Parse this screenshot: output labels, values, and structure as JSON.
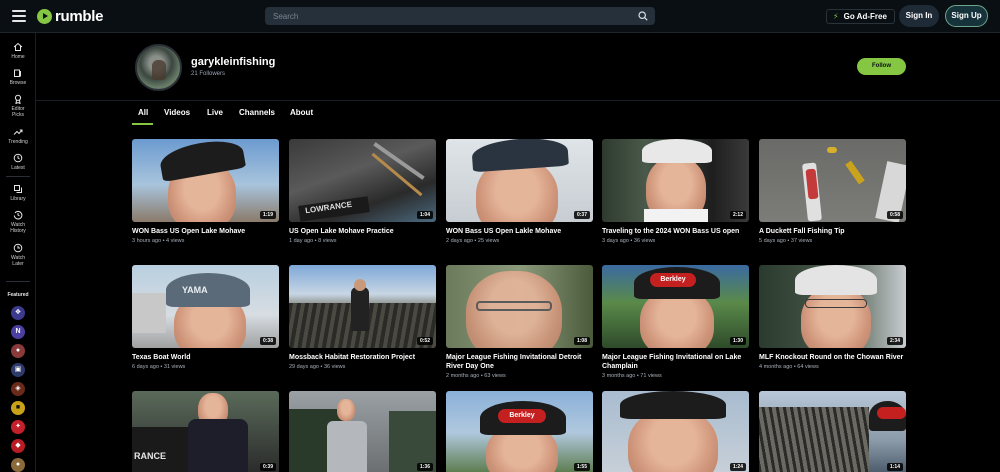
{
  "header": {
    "logo_text": "rumble",
    "search_placeholder": "Search",
    "go_ad_free": "Go Ad-Free",
    "sign_in": "Sign In",
    "sign_up": "Sign Up"
  },
  "sidebar": {
    "items": [
      {
        "label": "Home",
        "icon": "home-icon"
      },
      {
        "label": "Browse",
        "icon": "browse-icon"
      },
      {
        "label": "Editor Picks",
        "icon": "award-icon"
      },
      {
        "label": "Trending",
        "icon": "trending-icon"
      },
      {
        "label": "Latest",
        "icon": "clock-icon"
      },
      {
        "label": "Library",
        "icon": "library-icon"
      },
      {
        "label": "Watch History",
        "icon": "history-icon"
      },
      {
        "label": "Watch Later",
        "icon": "watch-later-icon"
      }
    ],
    "featured_title": "Featured"
  },
  "channel": {
    "name": "garykleinfishing",
    "followers": "21 Followers",
    "follow_label": "Follow"
  },
  "tabs": [
    "All",
    "Videos",
    "Live",
    "Channels",
    "About"
  ],
  "videos": [
    {
      "title": "WON Bass US Open Lake Mohave",
      "meta": "3 hours ago • 4 views",
      "duration": "1:19"
    },
    {
      "title": "US Open Lake Mohave Practice",
      "meta": "1 day ago • 8 views",
      "duration": "1:04"
    },
    {
      "title": "WON Bass US Open Lakle Mohave",
      "meta": "2 days ago • 25 views",
      "duration": "0:37"
    },
    {
      "title": "Traveling to the 2024 WON Bass US open",
      "meta": "3 days ago • 36 views",
      "duration": "2:12"
    },
    {
      "title": "A Duckett Fall Fishing Tip",
      "meta": "5 days ago • 37 views",
      "duration": "0:58"
    },
    {
      "title": "Texas Boat World",
      "meta": "6 days ago • 31 views",
      "duration": "0:38"
    },
    {
      "title": "Mossback Habitat Restoration Project",
      "meta": "29 days ago • 36 views",
      "duration": "0:52"
    },
    {
      "title": "Major League Fishing Invitational Detroit River Day One",
      "meta": "2 months ago • 63 views",
      "duration": "1:08"
    },
    {
      "title": "Major League Fishing Invitational on Lake Champlain",
      "meta": "3 months ago • 71 views",
      "duration": "1:30"
    },
    {
      "title": "MLF Knockout Round on the Chowan River",
      "meta": "4 months ago • 64 views",
      "duration": "2:34"
    },
    {
      "title": "",
      "meta": "",
      "duration": "0:39"
    },
    {
      "title": "",
      "meta": "",
      "duration": "1:36"
    },
    {
      "title": "",
      "meta": "",
      "duration": "1:55"
    },
    {
      "title": "",
      "meta": "",
      "duration": "1:24"
    },
    {
      "title": "",
      "meta": "",
      "duration": "1:14"
    }
  ],
  "colors": {
    "accent": "#85c742",
    "header_bg": "#0a0f14",
    "page_bg": "#000000"
  }
}
